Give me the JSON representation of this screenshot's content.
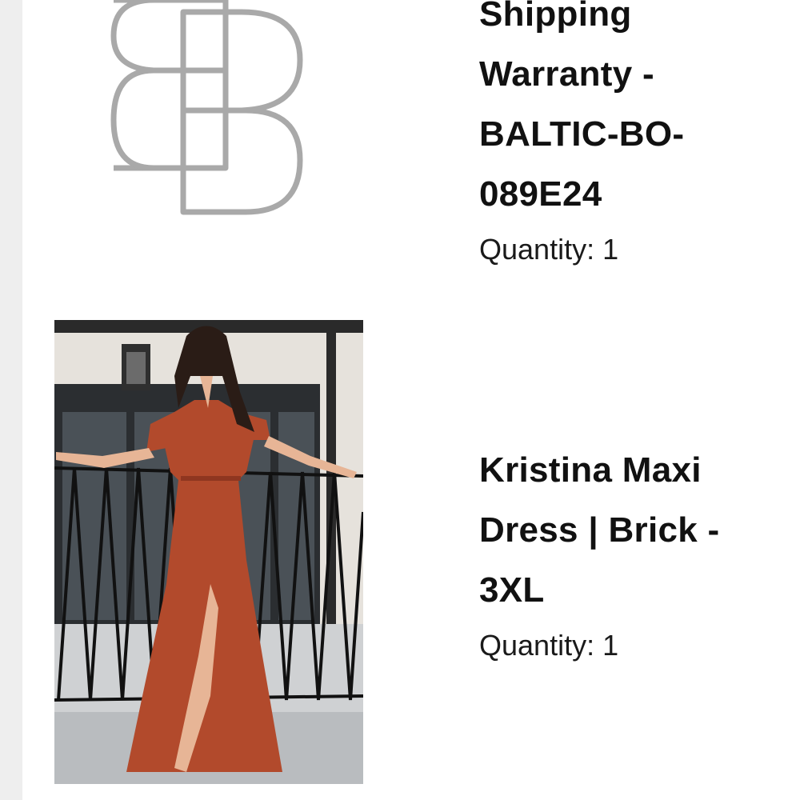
{
  "items": [
    {
      "title": "Shipping Warranty - BALTIC-BO-089E24",
      "quantity_label": "Quantity:",
      "quantity_value": "1",
      "thumbnail": "brand-logo-bb"
    },
    {
      "title": "Kristina Maxi Dress | Brick - 3XL",
      "quantity_label": "Quantity:",
      "quantity_value": "1",
      "thumbnail": "dress-photo"
    }
  ],
  "colors": {
    "logo_stroke": "#a9a9a9",
    "dress": "#b24a2c",
    "rail": "#eeeeee"
  }
}
